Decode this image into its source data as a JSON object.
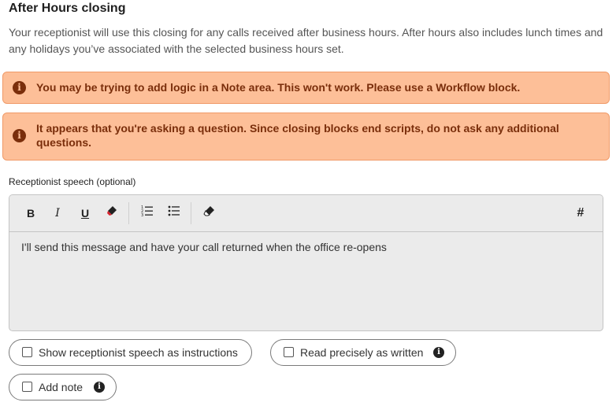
{
  "section": {
    "title": "After Hours closing",
    "description": "Your receptionist will use this closing for any calls received after business hours. After hours also includes lunch times and any holidays you’ve associated with the selected business hours set."
  },
  "alerts": [
    {
      "icon": "info-icon",
      "text": "You may be trying to add logic in a Note area. This won't work. Please use a Workflow block."
    },
    {
      "icon": "info-icon",
      "text": "It appears that you're asking a question. Since closing blocks end scripts, do not ask any additional questions."
    }
  ],
  "colors": {
    "alert_bg": "#fdbf98",
    "alert_border": "#f09a68",
    "alert_text": "#7a2e0b",
    "editor_bg": "#ebebeb"
  },
  "speech": {
    "label": "Receptionist speech (optional)",
    "toolbar": {
      "bold": "B",
      "italic": "I",
      "underline": "U",
      "hash": "#"
    },
    "content": "I'll send this message and have your call returned when the office re-opens"
  },
  "options": [
    {
      "label": "Show receptionist speech as instructions",
      "checked": false
    },
    {
      "label": "Read precisely as written",
      "checked": false,
      "icon": "info-icon"
    },
    {
      "label": "Add note",
      "checked": false,
      "icon": "info-icon"
    }
  ]
}
